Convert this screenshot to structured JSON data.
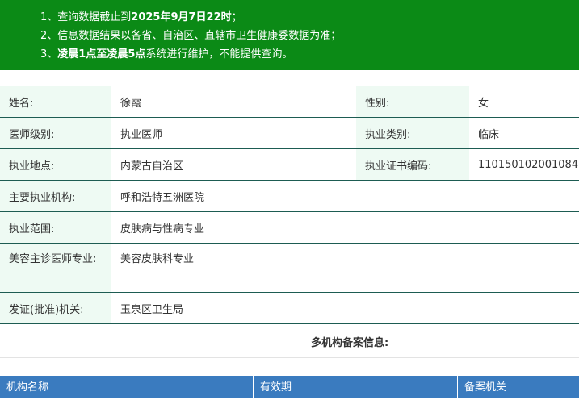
{
  "notice": {
    "line1": {
      "pre": "1、查询数据截止到",
      "bold": "2025年9月7日22时",
      "post": "；"
    },
    "line2": "2、信息数据结果以各省、自治区、直辖市卫生健康委数据为准；",
    "line3": {
      "pre": "3、",
      "bold": "凌晨1点至凌晨5点",
      "post": "系统进行维护，不能提供查询。"
    },
    "colors": {
      "background": "#0b8a16",
      "text": "#ffffff"
    }
  },
  "doctor": {
    "name_label": "姓名:",
    "name_value": "徐霞",
    "gender_label": "性别:",
    "gender_value": "女",
    "level_label": "医师级别:",
    "level_value": "执业医师",
    "category_label": "执业类别:",
    "category_value": "临床",
    "location_label": "执业地点:",
    "location_value": "内蒙古自治区",
    "cert_label": "执业证书编码:",
    "cert_value": "110150102001084",
    "org_label": "主要执业机构:",
    "org_value": "呼和浩特五洲医院",
    "scope_label": "执业范围:",
    "scope_value": "皮肤病与性病专业",
    "cosmetic_label": "美容主诊医师专业:",
    "cosmetic_value": "美容皮肤科专业",
    "issuer_label": "发证(批准)机关:",
    "issuer_value": "玉泉区卫生局"
  },
  "multi_org": {
    "title": "多机构备案信息:",
    "columns": [
      "机构名称",
      "有效期",
      "备案机关"
    ],
    "header_color": "#3a7bbf"
  }
}
